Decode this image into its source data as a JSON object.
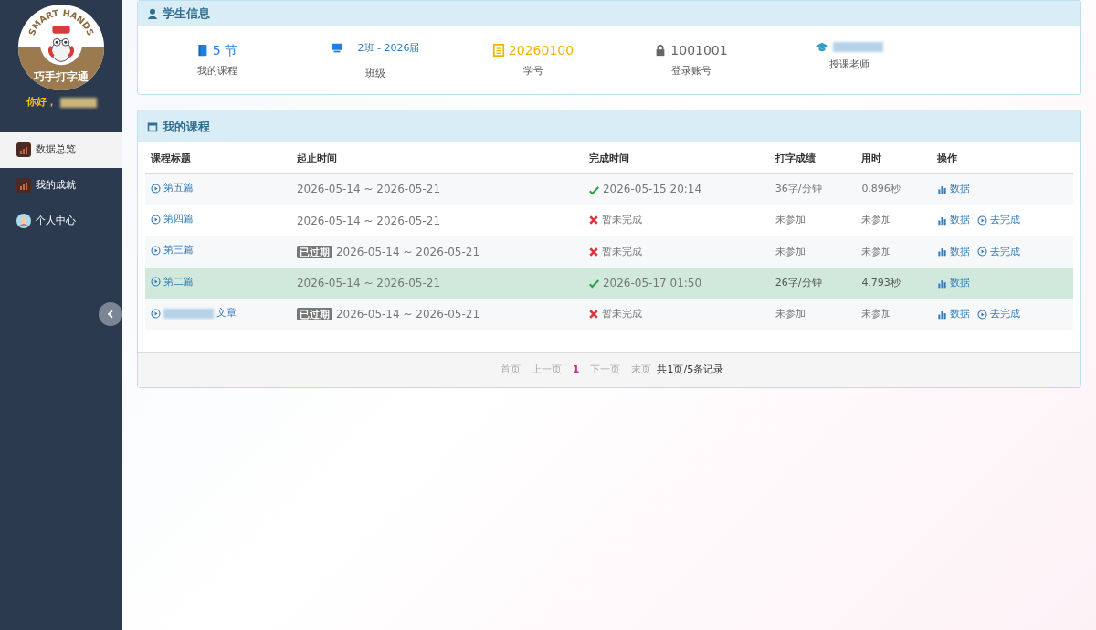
{
  "sidebar": {
    "logo": {
      "top_text": "SMART HANDS",
      "bottom_text": "巧手打字通"
    },
    "greeting": "你好，",
    "items": [
      {
        "label": "数据总览",
        "kind": "chart",
        "selected": true
      },
      {
        "label": "我的成就",
        "kind": "chart",
        "selected": false
      },
      {
        "label": "个人中心",
        "kind": "avatar",
        "selected": false
      }
    ]
  },
  "student_info": {
    "title": "学生信息",
    "stats": [
      {
        "kind": "book",
        "value": "5 节",
        "label": "我的课程"
      },
      {
        "kind": "screen",
        "value": "2班 - 2026届",
        "label": "班级"
      },
      {
        "kind": "list",
        "value": "20260100",
        "label": "学号"
      },
      {
        "kind": "lock",
        "value": "1001001",
        "label": "登录账号"
      },
      {
        "kind": "cap",
        "label": "授课老师"
      }
    ]
  },
  "courses": {
    "title": "我的课程",
    "columns": [
      "课程标题",
      "起止时间",
      "完成时间",
      "打字成绩",
      "用时",
      "操作"
    ],
    "rows": [
      {
        "title": "第五篇",
        "title_redacted": false,
        "expired": false,
        "period": "2026-05-14 ~ 2026-05-21",
        "done": true,
        "finished": "2026-05-15 20:14",
        "score": "36字/分钟",
        "time": "0.896秒",
        "selected": false,
        "actions": [
          "数据"
        ]
      },
      {
        "title": "第四篇",
        "title_redacted": false,
        "expired": false,
        "period": "2026-05-14 ~ 2026-05-21",
        "done": false,
        "finished": "暂未完成",
        "score": "未参加",
        "time": "未参加",
        "selected": false,
        "actions": [
          "数据",
          "去完成"
        ]
      },
      {
        "title": "第三篇",
        "title_redacted": false,
        "expired": true,
        "expired_label": "已过期",
        "period": "2026-05-14 ~ 2026-05-21",
        "done": false,
        "finished": "暂未完成",
        "score": "未参加",
        "time": "未参加",
        "selected": false,
        "actions": [
          "数据",
          "去完成"
        ]
      },
      {
        "title": "第二篇",
        "title_redacted": false,
        "expired": false,
        "period": "2026-05-14 ~ 2026-05-21",
        "done": true,
        "finished": "2026-05-17 01:50",
        "score": "26字/分钟",
        "time": "4.793秒",
        "selected": true,
        "actions": [
          "数据"
        ]
      },
      {
        "title": "文章",
        "title_redacted": true,
        "expired": true,
        "expired_label": "已过期",
        "period": "2026-05-14 ~ 2026-05-21",
        "done": false,
        "finished": "暂未完成",
        "score": "未参加",
        "time": "未参加",
        "selected": false,
        "actions": [
          "数据",
          "去完成"
        ]
      }
    ],
    "pagination": [
      {
        "label": "首页",
        "selected": false
      },
      {
        "label": "上一页",
        "selected": false
      },
      {
        "label": "1",
        "selected": true
      },
      {
        "label": "下一页",
        "selected": false
      },
      {
        "label": "末页",
        "selected": false
      }
    ],
    "summary": "共1页/5条记录"
  }
}
